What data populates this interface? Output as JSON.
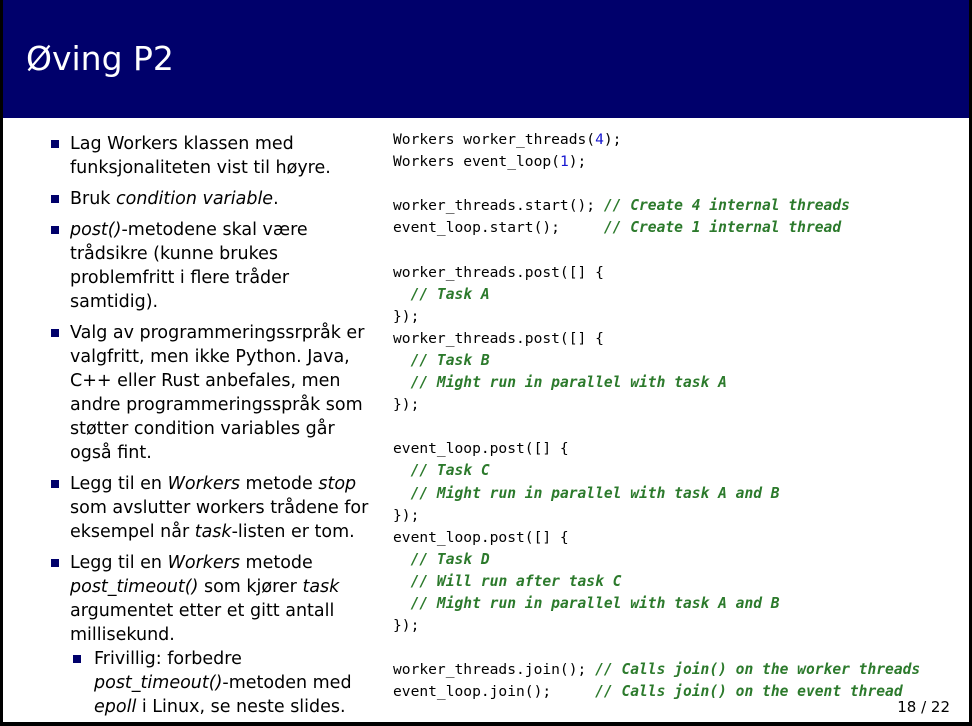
{
  "slide": {
    "title": "Øving P2",
    "page_number": "18 / 22"
  },
  "bullets": [
    [
      {
        "t": "Lag Workers klassen med funksjonaliteten vist til høyre."
      }
    ],
    [
      {
        "t": "Bruk "
      },
      {
        "t": "condition variable",
        "i": true
      },
      {
        "t": "."
      }
    ],
    [
      {
        "t": "post()",
        "i": true
      },
      {
        "t": "-metodene skal være trådsikre (kunne brukes problemfritt i flere tråder samtidig)."
      }
    ],
    [
      {
        "t": "Valg av programmeringssrpråk er valgfritt, men ikke Python. Java, C++ eller Rust anbefales, men andre programmeringsspråk som støtter condition variables går også fint."
      }
    ],
    [
      {
        "t": "Legg til en "
      },
      {
        "t": "Workers",
        "i": true
      },
      {
        "t": " metode "
      },
      {
        "t": "stop",
        "i": true
      },
      {
        "t": " som avslutter workers trådene for eksempel når "
      },
      {
        "t": "task",
        "i": true
      },
      {
        "t": "-listen er tom."
      }
    ],
    [
      {
        "t": "Legg til en "
      },
      {
        "t": "Workers",
        "i": true
      },
      {
        "t": " metode "
      },
      {
        "t": "post_timeout()",
        "i": true
      },
      {
        "t": " som kjører "
      },
      {
        "t": "task",
        "i": true
      },
      {
        "t": " argumentet etter et gitt antall millisekund."
      }
    ]
  ],
  "sub_bullets": [
    [
      {
        "t": "Frivillig: forbedre "
      },
      {
        "t": "post_timeout()",
        "i": true
      },
      {
        "t": "-metoden med "
      },
      {
        "t": "epoll",
        "i": true
      },
      {
        "t": " i Linux, se neste slides."
      }
    ]
  ],
  "code_lines": [
    [
      {
        "t": "Workers worker_threads("
      },
      {
        "t": "4",
        "c": "num"
      },
      {
        "t": ");"
      }
    ],
    [
      {
        "t": "Workers event_loop("
      },
      {
        "t": "1",
        "c": "num"
      },
      {
        "t": ");"
      }
    ],
    [],
    [
      {
        "t": "worker_threads.start(); "
      },
      {
        "t": "// Create 4 internal threads",
        "c": "cm"
      }
    ],
    [
      {
        "t": "event_loop.start();     "
      },
      {
        "t": "// Create 1 internal thread",
        "c": "cm"
      }
    ],
    [],
    [
      {
        "t": "worker_threads.post([] {"
      }
    ],
    [
      {
        "t": "  "
      },
      {
        "t": "// Task A",
        "c": "cm"
      }
    ],
    [
      {
        "t": "});"
      }
    ],
    [
      {
        "t": "worker_threads.post([] {"
      }
    ],
    [
      {
        "t": "  "
      },
      {
        "t": "// Task B",
        "c": "cm"
      }
    ],
    [
      {
        "t": "  "
      },
      {
        "t": "// Might run in parallel with task A",
        "c": "cm"
      }
    ],
    [
      {
        "t": "});"
      }
    ],
    [],
    [
      {
        "t": "event_loop.post([] {"
      }
    ],
    [
      {
        "t": "  "
      },
      {
        "t": "// Task C",
        "c": "cm"
      }
    ],
    [
      {
        "t": "  "
      },
      {
        "t": "// Might run in parallel with task A and B",
        "c": "cm"
      }
    ],
    [
      {
        "t": "});"
      }
    ],
    [
      {
        "t": "event_loop.post([] {"
      }
    ],
    [
      {
        "t": "  "
      },
      {
        "t": "// Task D",
        "c": "cm"
      }
    ],
    [
      {
        "t": "  "
      },
      {
        "t": "// Will run after task C",
        "c": "cm"
      }
    ],
    [
      {
        "t": "  "
      },
      {
        "t": "// Might run in parallel with task A and B",
        "c": "cm"
      }
    ],
    [
      {
        "t": "});"
      }
    ],
    [],
    [
      {
        "t": "worker_threads.join(); "
      },
      {
        "t": "// Calls join() on the worker threads",
        "c": "cm"
      }
    ],
    [
      {
        "t": "event_loop.join();     "
      },
      {
        "t": "// Calls join() on the event thread",
        "c": "cm"
      }
    ]
  ],
  "colors": {
    "title_bar": "#00006b",
    "bullet": "#00006b",
    "comment": "#2c7a2c",
    "number": "#1515d0"
  }
}
